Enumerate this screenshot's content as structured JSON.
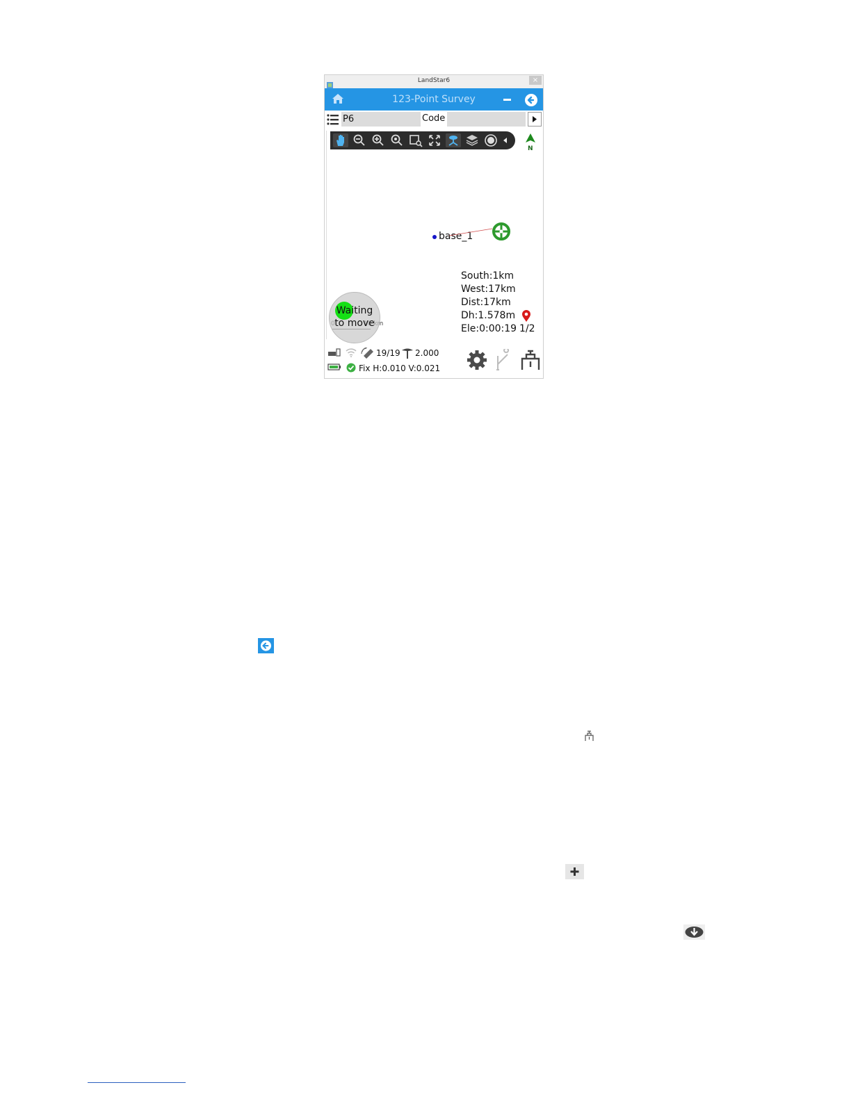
{
  "window": {
    "title": "LandStar6",
    "close_label": "×"
  },
  "appbar": {
    "title": "123-Point Survey"
  },
  "input_row": {
    "point_name": "P6",
    "code_label": "Code",
    "code_value": ""
  },
  "map": {
    "point_label": "base_1",
    "scale_start": "0",
    "scale_end": "10 km",
    "waiting_text": "Waiting to move",
    "info": {
      "south": "South:1km",
      "west": "West:17km",
      "dist": "Dist:17km",
      "dh": "Dh:1.578m",
      "ele": "Ele:0:00:19"
    },
    "page_indicator": "1/2"
  },
  "status": {
    "satellites": "19/19",
    "antenna_height": "2.000",
    "fix": "Fix H:0.010 V:0.021"
  },
  "colors": {
    "appbar": "#2595e4",
    "toolbar": "#2c2c2c",
    "crosshair": "#2e9a2e",
    "fix_ok": "#3cb043",
    "pin": "#d81b1b"
  },
  "icons": [
    "home-icon",
    "minus-icon",
    "back-arrow-icon",
    "list-icon",
    "next-arrow-icon",
    "pan-icon",
    "zoom-out-icon",
    "zoom-in-icon",
    "zoom-extent-icon",
    "zoom-window-icon",
    "full-extent-icon",
    "receiver-view-icon",
    "layer-icon",
    "record-icon",
    "collapse-arrow-icon",
    "north-arrow-icon",
    "crosshair-icon",
    "pin-icon",
    "gear-icon",
    "stakeout-pole-icon",
    "measure-icon",
    "back-arrow-icon",
    "measure-icon",
    "plus-icon",
    "download-icon"
  ]
}
